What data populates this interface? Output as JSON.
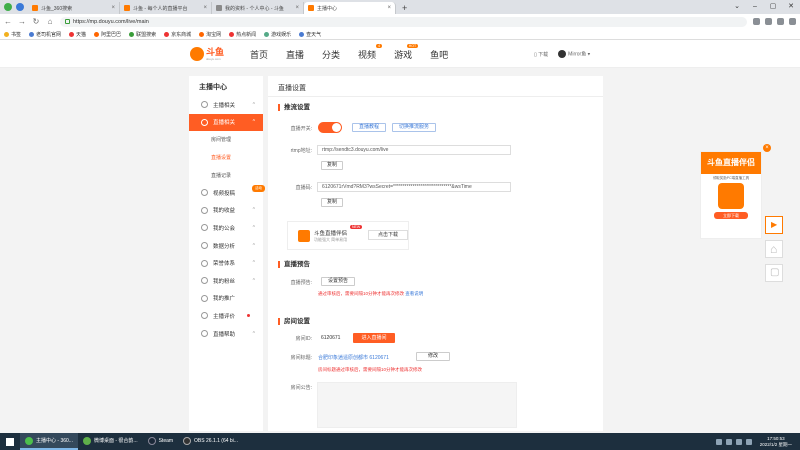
{
  "browser": {
    "tabs": [
      {
        "label": "斗鱼_360搜索",
        "active": false
      },
      {
        "label": "斗鱼 - 每个人的直播平台",
        "active": false
      },
      {
        "label": "我的资料 - 个人中心 - 斗鱼",
        "active": false
      },
      {
        "label": "主播中心",
        "active": true
      }
    ],
    "url": "https://mp.douyu.com/live/main",
    "bookmarks": [
      "书签",
      "老司机官网",
      "天猫",
      "阿里巴巴",
      "联盟搜索",
      "京东商城",
      "淘宝网",
      "热点新闻",
      "游戏娱乐",
      "查天气"
    ]
  },
  "site": {
    "logo": "斗鱼",
    "logo_sub": "douyu.com",
    "nav": [
      "首页",
      "直播",
      "分类",
      "视频",
      "游戏",
      "鱼吧"
    ],
    "nav_badge_video": "4",
    "nav_badge_game": "HOT",
    "download": "下载",
    "username": "Mirror鱼"
  },
  "sidebar": {
    "title": "主播中心",
    "items": [
      {
        "label": "主播相关",
        "arrow": "^"
      },
      {
        "label": "直播相关",
        "arrow": "^",
        "active": true
      },
      {
        "label": "房间管理",
        "sub": true
      },
      {
        "label": "直播设置",
        "sub": true,
        "current": true
      },
      {
        "label": "直播记录",
        "sub": true
      },
      {
        "label": "视频投稿",
        "arrow": "^",
        "hot": "活动"
      },
      {
        "label": "我的收益",
        "arrow": "^"
      },
      {
        "label": "我的公会",
        "arrow": "^"
      },
      {
        "label": "数据分析",
        "arrow": "^"
      },
      {
        "label": "荣誉体系",
        "arrow": "^"
      },
      {
        "label": "我的粉丝",
        "arrow": "^"
      },
      {
        "label": "我的推广",
        "arrow": ""
      },
      {
        "label": "主播评价",
        "arrow": "",
        "dot": true
      },
      {
        "label": "直播帮助",
        "arrow": "^"
      }
    ]
  },
  "main": {
    "title": "直播设置",
    "stream": {
      "section": "推流设置",
      "switch_label": "直播开关:",
      "tutorial_btn": "直播教程",
      "pc_tool_btn": "切换推流服务",
      "rtmp_label": "rtmp地址:",
      "rtmp_value": "rtmp://sendtc3.douyu.com/live",
      "copy1": "复制",
      "code_label": "直播码:",
      "code_value": "6120671rVmd?RM3?wsSecret=******************************&wsTime",
      "copy2": "复制"
    },
    "promo": {
      "title": "斗鱼直播伴侣",
      "badge": "NEW",
      "subtitle": "功能强大 简单易用",
      "download": "点击下载"
    },
    "notice": {
      "section": "直播预告",
      "label": "直播预告:",
      "set_btn": "设置预告",
      "warning": "通过审核后，需要间隔10分钟才能再次修改",
      "link": "查看说明"
    },
    "room": {
      "section": "房间设置",
      "id_label": "房间ID:",
      "id_value": "6120671",
      "enter_btn": "进入直播间",
      "title_label": "房间标题:",
      "title_value": "合肥印象逍遥原创都市 6120671",
      "edit_btn": "修改",
      "title_warning": "房间标题通过审核后，需要间隔10分钟才能再次修改",
      "announce_label": "房间公告:"
    }
  },
  "ad": {
    "title": "斗鱼直播伴侣",
    "desc": "领取奖励PC端直播工具",
    "button": "立即下载"
  },
  "taskbar": {
    "apps": [
      {
        "label": "主播中心 - 360...",
        "active": true
      },
      {
        "label": "微博桌面 - 很合韵...",
        "active": false
      },
      {
        "label": "Steam",
        "active": false
      },
      {
        "label": "OBS 26.1.1 (64 bi...",
        "active": false
      }
    ],
    "time": "17:50:53",
    "date": "2022/1/2 星期一"
  }
}
